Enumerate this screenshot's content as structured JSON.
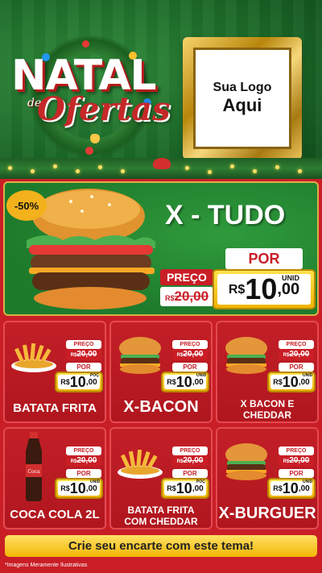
{
  "header": {
    "title_main": "NATAL",
    "title_de": "de",
    "title_sub": "Ofertas",
    "logo_line1": "Sua Logo",
    "logo_line2": "Aqui"
  },
  "featured": {
    "discount_badge": "-50%",
    "name": "X - TUDO",
    "preco_label": "PREÇO",
    "old_currency": "R$",
    "old_price": "20,00",
    "por_label": "POR",
    "unit": "UNID",
    "currency": "R$",
    "price_int": "10",
    "price_dec": ",00"
  },
  "products": [
    {
      "name_line1": "BATATA FRITA",
      "name_line2": "",
      "preco_label": "PREÇO",
      "old_currency": "R$",
      "old_price": "20,00",
      "por_label": "POR",
      "unit": "POÇ",
      "currency": "R$",
      "price_int": "10",
      "price_dec": ",00",
      "icon": "fries-icon"
    },
    {
      "name_line1": "X-BACON",
      "name_line2": "",
      "preco_label": "PREÇO",
      "old_currency": "R$",
      "old_price": "20,00",
      "por_label": "POR",
      "unit": "UNID",
      "currency": "R$",
      "price_int": "10",
      "price_dec": ",00",
      "icon": "burger-icon"
    },
    {
      "name_line1": "X BACON E",
      "name_line2": "CHEDDAR",
      "preco_label": "PREÇO",
      "old_currency": "R$",
      "old_price": "20,00",
      "por_label": "POR",
      "unit": "UNID",
      "currency": "R$",
      "price_int": "10",
      "price_dec": ",00",
      "icon": "burger-icon"
    },
    {
      "name_line1": "COCA COLA 2L",
      "name_line2": "",
      "preco_label": "PREÇO",
      "old_currency": "R$",
      "old_price": "20,00",
      "por_label": "POR",
      "unit": "UNID",
      "currency": "R$",
      "price_int": "10",
      "price_dec": ",00",
      "icon": "soda-bottle-icon"
    },
    {
      "name_line1": "BATATA FRITA",
      "name_line2": "COM CHEDDAR",
      "preco_label": "PREÇO",
      "old_currency": "R$",
      "old_price": "20,00",
      "por_label": "POR",
      "unit": "POÇ",
      "currency": "R$",
      "price_int": "10",
      "price_dec": ",00",
      "icon": "fries-icon"
    },
    {
      "name_line1": "X-BURGUER",
      "name_line2": "",
      "preco_label": "PREÇO",
      "old_currency": "R$",
      "old_price": "20,00",
      "por_label": "POR",
      "unit": "UNID",
      "currency": "R$",
      "price_int": "10",
      "price_dec": ",00",
      "icon": "burger-icon"
    }
  ],
  "footer": {
    "cta": "Crie seu encarte com este tema!",
    "disclaimer": "*Imagens Meramente Ilustrativas"
  },
  "colors": {
    "green": "#1e7b2c",
    "red": "#c91e26",
    "gold": "#f2b705"
  }
}
